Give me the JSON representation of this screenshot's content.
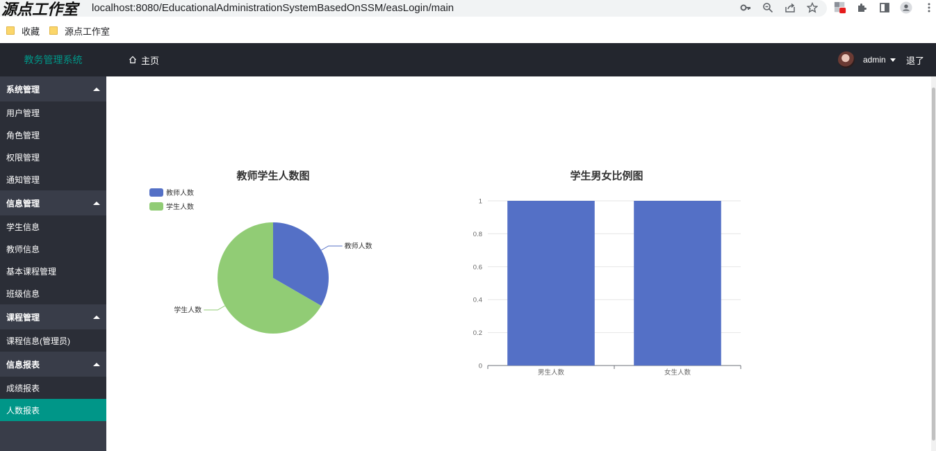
{
  "browser": {
    "watermark": "源点工作室",
    "url": "localhost:8080/EducationalAdministrationSystemBasedOnSSM/easLogin/main",
    "bookmarks": [
      {
        "label": "收藏"
      },
      {
        "label": "源点工作室"
      }
    ]
  },
  "header": {
    "app_title": "教务管理系统",
    "home_label": "主页",
    "user_name": "admin",
    "logout_label": "退了"
  },
  "sidebar": {
    "groups": [
      {
        "label": "系统管理",
        "items": [
          "用户管理",
          "角色管理",
          "权限管理",
          "通知管理"
        ]
      },
      {
        "label": "信息管理",
        "items": [
          "学生信息",
          "教师信息",
          "基本课程管理",
          "班级信息"
        ]
      },
      {
        "label": "课程管理",
        "items": [
          "课程信息(管理员)"
        ]
      },
      {
        "label": "信息报表",
        "items": [
          "成绩报表",
          "人数报表"
        ]
      }
    ],
    "active_item": "人数报表"
  },
  "chart_data": [
    {
      "type": "pie",
      "title": "教师学生人数图",
      "legend": [
        "教师人数",
        "学生人数"
      ],
      "legend_position": "top-left",
      "labels": [
        "教师人数",
        "学生人数"
      ],
      "values": [
        1,
        2
      ],
      "colors": [
        "#5470c6",
        "#91cc75"
      ]
    },
    {
      "type": "bar",
      "title": "学生男女比例图",
      "categories": [
        "男生人数",
        "女生人数"
      ],
      "values": [
        1,
        1
      ],
      "ylim": [
        0,
        1
      ],
      "yticks": [
        "0",
        "0.2",
        "0.4",
        "0.6",
        "0.8",
        "1"
      ],
      "grid": true,
      "color": "#5470c6"
    }
  ]
}
